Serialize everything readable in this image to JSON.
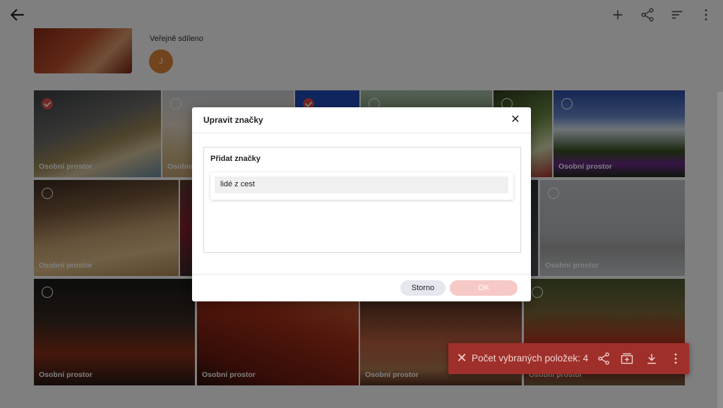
{
  "header": {
    "shared_label": "Veřejně sdíleno",
    "avatar_initial": "J"
  },
  "photos": {
    "label": "Osobní prostor"
  },
  "dialog": {
    "title": "Upravit značky",
    "section_title": "Přidat značky",
    "tags": [
      "lidé z cest"
    ],
    "cancel_label": "Storno",
    "ok_label": "OK"
  },
  "action_bar": {
    "count_text": "Počet vybraných položek: 4"
  },
  "colors": {
    "accent": "#e0524a",
    "action_bar": "#9e2f2a",
    "avatar": "#e2893a"
  }
}
